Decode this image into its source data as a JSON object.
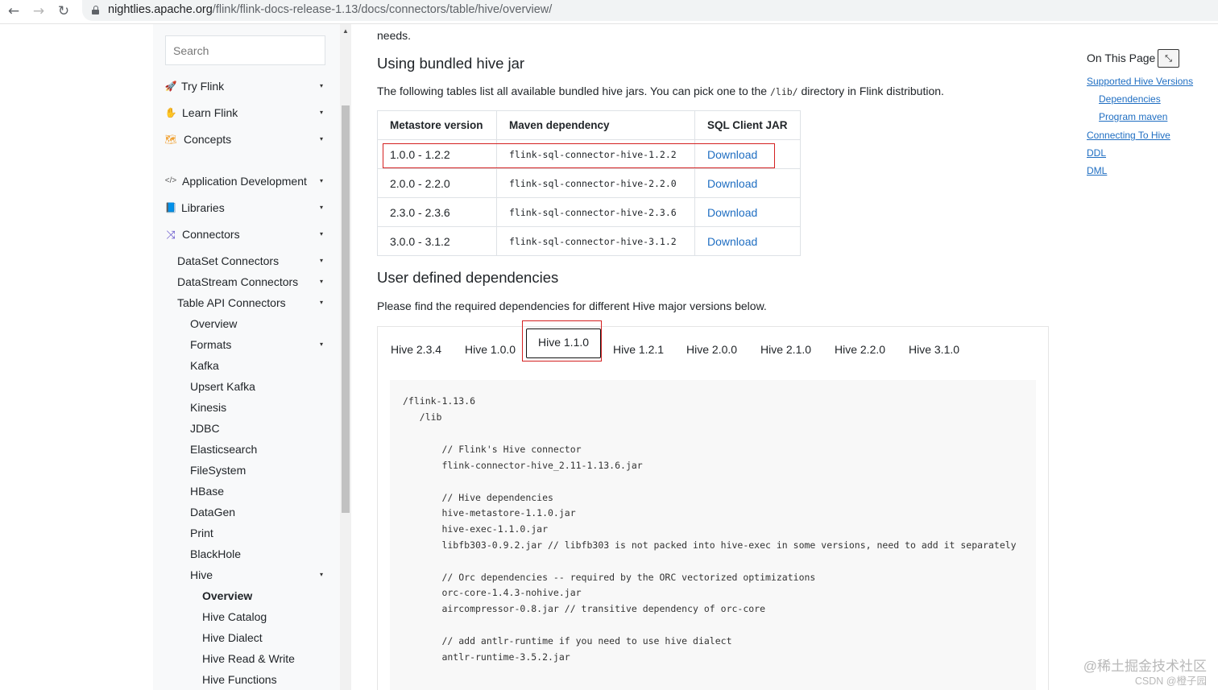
{
  "browser": {
    "back_icon": "←",
    "forward_icon": "→",
    "reload_icon": "↻",
    "url_domain": "nightlies.apache.org",
    "url_path": "/flink/flink-docs-release-1.13/docs/connectors/table/hive/overview/"
  },
  "sidebar": {
    "search_placeholder": "Search",
    "items": [
      {
        "label": "Try Flink",
        "icon": "rocket-icon",
        "glyph": "🚀",
        "caret": "▾"
      },
      {
        "label": "Learn Flink",
        "icon": "hand-icon",
        "glyph": "✋",
        "caret": "▾"
      },
      {
        "label": "Concepts",
        "icon": "map-icon",
        "glyph": "🗺",
        "caret": "▾"
      },
      {
        "label": "Application Development",
        "icon": "code-icon",
        "glyph": "</>",
        "caret": "▾"
      },
      {
        "label": "Libraries",
        "icon": "book-icon",
        "glyph": "📘",
        "caret": "▾"
      },
      {
        "label": "Connectors",
        "icon": "shuffle-icon",
        "glyph": "⤨",
        "caret": "▾"
      },
      {
        "label": "DataSet Connectors",
        "caret": "▾"
      },
      {
        "label": "DataStream Connectors",
        "caret": "▾"
      },
      {
        "label": "Table API Connectors",
        "caret": "▾"
      },
      {
        "label": "Overview"
      },
      {
        "label": "Formats",
        "caret": "▾"
      },
      {
        "label": "Kafka"
      },
      {
        "label": "Upsert Kafka"
      },
      {
        "label": "Kinesis"
      },
      {
        "label": "JDBC"
      },
      {
        "label": "Elasticsearch"
      },
      {
        "label": "FileSystem"
      },
      {
        "label": "HBase"
      },
      {
        "label": "DataGen"
      },
      {
        "label": "Print"
      },
      {
        "label": "BlackHole"
      },
      {
        "label": "Hive",
        "caret": "▾"
      },
      {
        "label": "Overview"
      },
      {
        "label": "Hive Catalog"
      },
      {
        "label": "Hive Dialect"
      },
      {
        "label": "Hive Read & Write"
      },
      {
        "label": "Hive Functions"
      }
    ]
  },
  "main": {
    "needs_text": "needs.",
    "bundled_heading": "Using bundled hive jar",
    "bundled_desc_before": "The following tables list all available bundled hive jars. You can pick one to the",
    "bundled_desc_code": "/lib/",
    "bundled_desc_after": "directory in Flink distribution.",
    "table": {
      "headers": [
        "Metastore version",
        "Maven dependency",
        "SQL Client JAR"
      ],
      "rows": [
        [
          "1.0.0 - 1.2.2",
          "flink-sql-connector-hive-1.2.2",
          "Download"
        ],
        [
          "2.0.0 - 2.2.0",
          "flink-sql-connector-hive-2.2.0",
          "Download"
        ],
        [
          "2.3.0 - 2.3.6",
          "flink-sql-connector-hive-2.3.6",
          "Download"
        ],
        [
          "3.0.0 - 3.1.2",
          "flink-sql-connector-hive-3.1.2",
          "Download"
        ]
      ]
    },
    "user_heading": "User defined dependencies",
    "user_desc": "Please find the required dependencies for different Hive major versions below.",
    "tabs": [
      "Hive 2.3.4",
      "Hive 1.0.0",
      "Hive 1.1.0",
      "Hive 1.2.1",
      "Hive 2.0.0",
      "Hive 2.1.0",
      "Hive 2.2.0",
      "Hive 3.1.0"
    ],
    "code_lines": [
      "/flink-1.13.6",
      "   /lib",
      "",
      "       // Flink's Hive connector",
      "       flink-connector-hive_2.11-1.13.6.jar",
      "",
      "       // Hive dependencies",
      "       hive-metastore-1.1.0.jar",
      "       hive-exec-1.1.0.jar",
      "       libfb303-0.9.2.jar // libfb303 is not packed into hive-exec in some versions, need to add it separately",
      "",
      "       // Orc dependencies -- required by the ORC vectorized optimizations",
      "       orc-core-1.4.3-nohive.jar",
      "       aircompressor-0.8.jar // transitive dependency of orc-core",
      "",
      "       // add antlr-runtime if you need to use hive dialect",
      "       antlr-runtime-3.5.2.jar"
    ]
  },
  "toc": {
    "title": "On This Page",
    "toggle_glyph": "⤡",
    "links": [
      "Supported Hive Versions",
      "Dependencies",
      "Program maven",
      "Connecting To Hive",
      "DDL",
      "DML"
    ]
  },
  "watermark": {
    "line1": "@稀土掘金技术社区",
    "line2": "CSDN @橙子园"
  },
  "colors": {
    "link": "#1f6ec2",
    "highlight": "#d42020",
    "sidebar_bg": "#f8f9fa"
  }
}
